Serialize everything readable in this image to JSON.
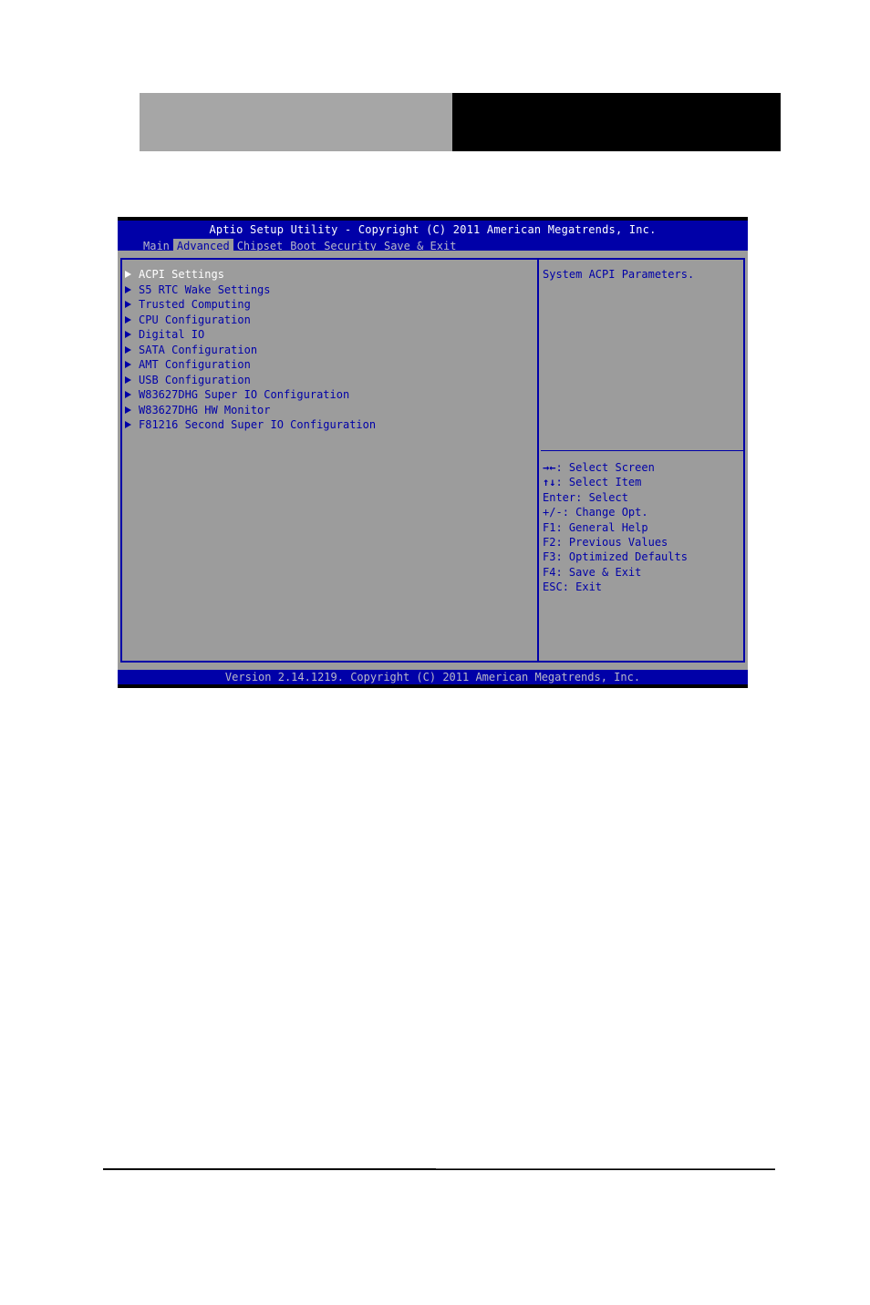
{
  "colors": {
    "bios_blue": "#0000a8",
    "bios_gray": "#9c9c9c",
    "header_gray": "#a6a6a6",
    "header_black": "#000000"
  },
  "bios": {
    "title": "Aptio Setup Utility - Copyright (C) 2011 American Megatrends, Inc.",
    "tabs": [
      {
        "label": "Main",
        "active": false
      },
      {
        "label": "Advanced",
        "active": true
      },
      {
        "label": "Chipset",
        "active": false
      },
      {
        "label": "Boot",
        "active": false
      },
      {
        "label": "Security",
        "active": false
      },
      {
        "label": "Save & Exit",
        "active": false
      }
    ],
    "menu_items": [
      {
        "label": "ACPI Settings",
        "selected": true
      },
      {
        "label": "S5 RTC Wake Settings",
        "selected": false
      },
      {
        "label": "Trusted Computing",
        "selected": false
      },
      {
        "label": "CPU Configuration",
        "selected": false
      },
      {
        "label": "Digital IO",
        "selected": false
      },
      {
        "label": "SATA Configuration",
        "selected": false
      },
      {
        "label": "AMT Configuration",
        "selected": false
      },
      {
        "label": "USB Configuration",
        "selected": false
      },
      {
        "label": "W83627DHG Super IO Configuration",
        "selected": false
      },
      {
        "label": "W83627DHG HW Monitor",
        "selected": false
      },
      {
        "label": "F81216 Second Super IO Configuration",
        "selected": false
      }
    ],
    "help_text": "System ACPI Parameters.",
    "key_help": [
      {
        "key": "→←",
        "desc": ": Select Screen"
      },
      {
        "key": "↑↓",
        "desc": ": Select Item"
      },
      {
        "key": "Enter",
        "desc": ": Select"
      },
      {
        "key": "+/-",
        "desc": ": Change Opt."
      },
      {
        "key": "F1",
        "desc": ": General Help"
      },
      {
        "key": "F2",
        "desc": ": Previous Values"
      },
      {
        "key": "F3",
        "desc": ": Optimized Defaults"
      },
      {
        "key": "F4",
        "desc": ": Save & Exit"
      },
      {
        "key": "ESC",
        "desc": ": Exit"
      }
    ],
    "footer": "Version 2.14.1219. Copyright (C) 2011 American Megatrends, Inc."
  }
}
